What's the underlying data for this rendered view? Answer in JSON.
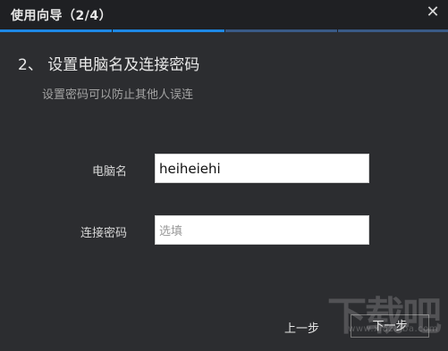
{
  "window": {
    "title": "使用向导（2/4）",
    "close_icon": "close-icon"
  },
  "progress": {
    "current_step": 2,
    "total_steps": 4,
    "active_color": "#1e88e5",
    "inactive_color": "#3a5a86"
  },
  "step": {
    "title": "2、 设置电脑名及连接密码",
    "subtitle": "设置密码可以防止其他人误连"
  },
  "form": {
    "computer_name_label": "电脑名",
    "computer_name_value": "heiheiehi",
    "password_label": "连接密码",
    "password_placeholder": "选填"
  },
  "buttons": {
    "prev_label": "上一步",
    "next_label": "下一步"
  },
  "watermark": {
    "text": "下载吧",
    "url_text": "www.xiazaiba.com"
  }
}
